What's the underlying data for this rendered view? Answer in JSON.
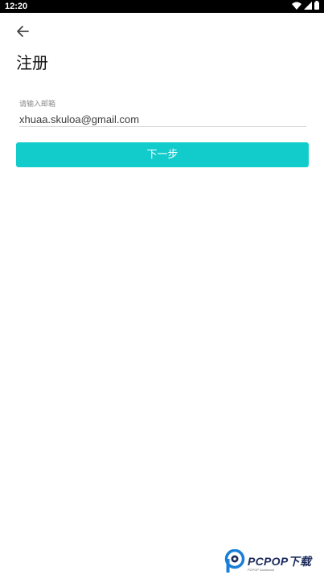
{
  "status_bar": {
    "time": "12:20",
    "icons": [
      "wifi-icon",
      "signal-icon",
      "battery-icon"
    ]
  },
  "header": {
    "back_icon": "arrow-left-icon",
    "title": "注册"
  },
  "form": {
    "email_label": "请输入邮箱",
    "email_value": "xhuaa.skuloa@gmail.com"
  },
  "actions": {
    "next_label": "下一步"
  },
  "watermark": {
    "brand": "PCPOP下载",
    "sub": "PCPOP Download"
  },
  "colors": {
    "accent": "#12CCCC",
    "status_bar_bg": "#000000",
    "watermark_blue": "#1A7FD6",
    "watermark_navy": "#1A2A5C"
  }
}
